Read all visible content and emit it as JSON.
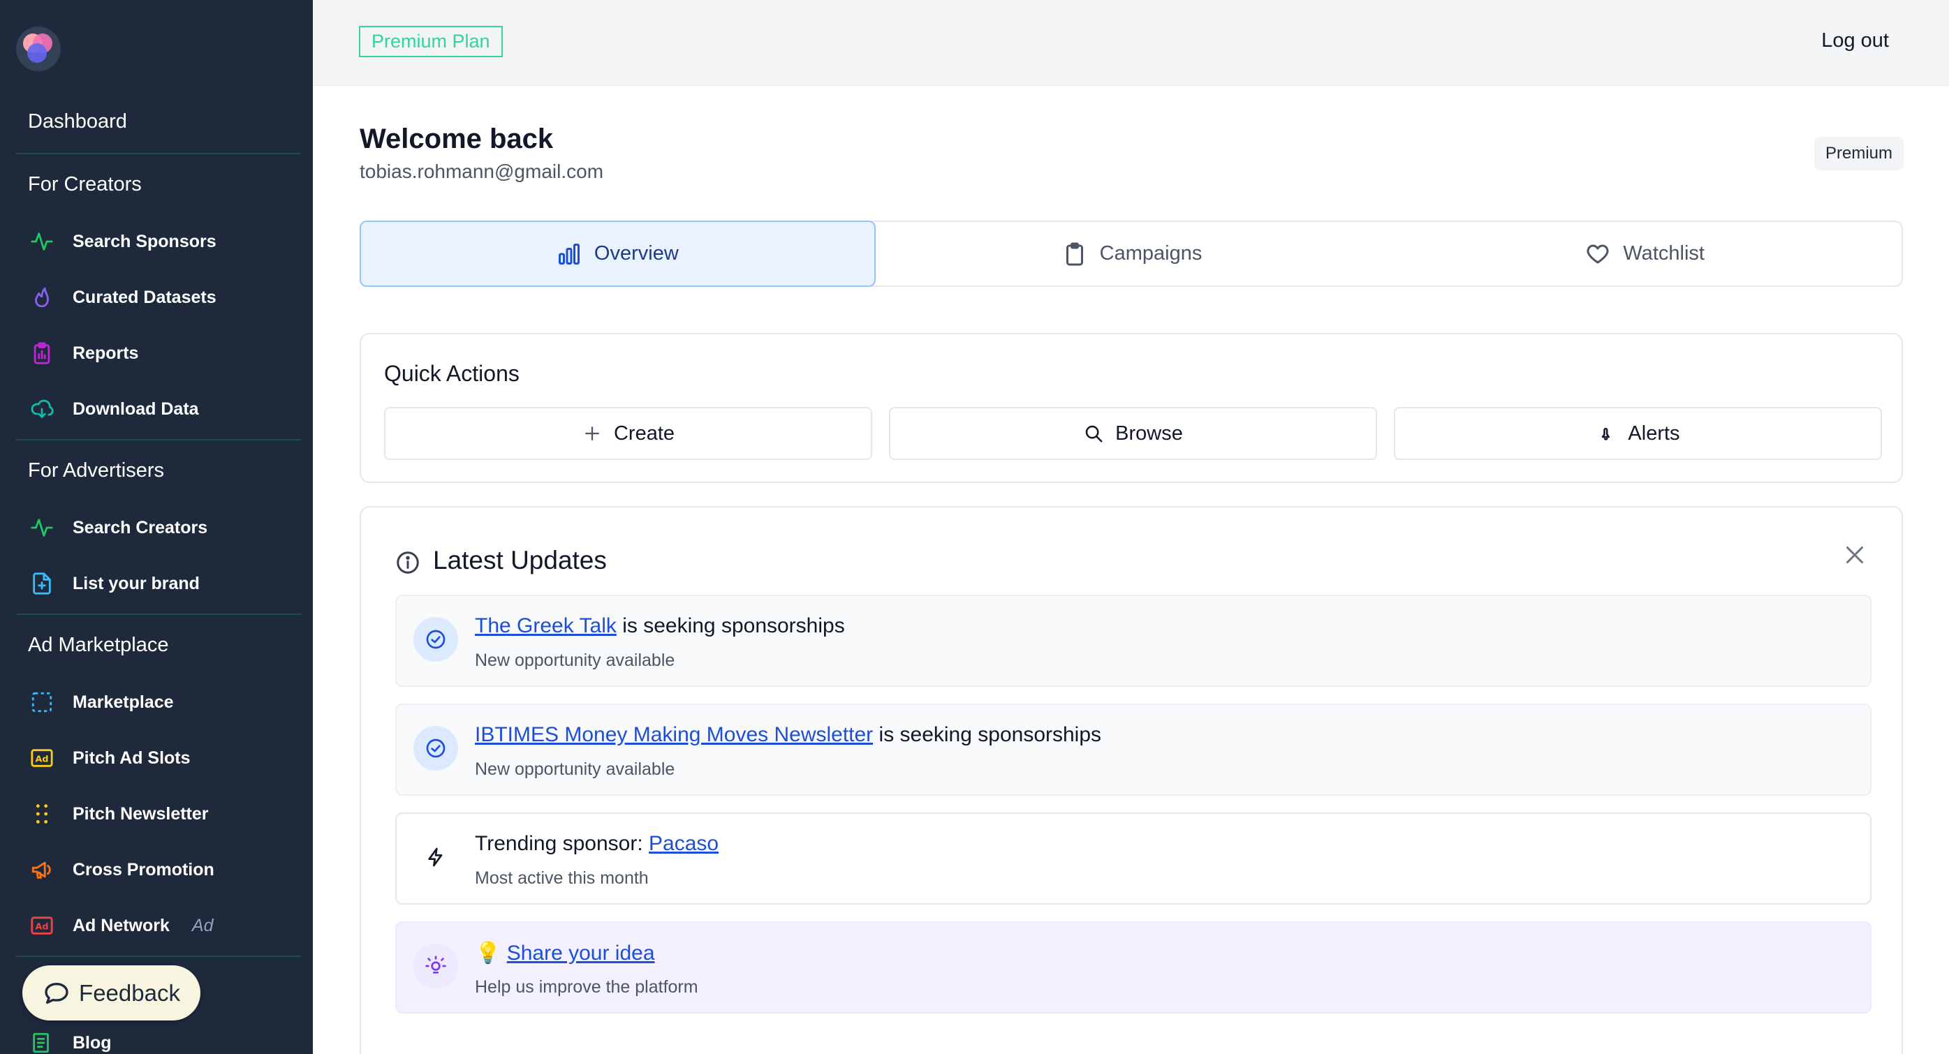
{
  "sidebar": {
    "sections": {
      "dashboard": "Dashboard",
      "creators": "For Creators",
      "advertisers": "For Advertisers",
      "marketplace": "Ad Marketplace"
    },
    "items": [
      {
        "label": "Search Sponsors",
        "icon": "activity-icon",
        "color": "#22c55e"
      },
      {
        "label": "Curated Datasets",
        "icon": "flame-icon",
        "color": "#8b5cf6"
      },
      {
        "label": "Reports",
        "icon": "clipboard-chart-icon",
        "color": "#c026d3"
      },
      {
        "label": "Download Data",
        "icon": "cloud-download-icon",
        "color": "#14b8a6"
      },
      {
        "label": "Search Creators",
        "icon": "activity-icon",
        "color": "#22c55e"
      },
      {
        "label": "List your brand",
        "icon": "file-plus-icon",
        "color": "#38bdf8"
      },
      {
        "label": "Marketplace",
        "icon": "dashed-square-icon",
        "color": "#38bdf8"
      },
      {
        "label": "Pitch Ad Slots",
        "icon": "ad-icon",
        "color": "#facc15"
      },
      {
        "label": "Pitch Newsletter",
        "icon": "dots-icon",
        "color": "#facc15"
      },
      {
        "label": "Cross Promotion",
        "icon": "megaphone-icon",
        "color": "#f97316"
      },
      {
        "label": "Ad Network",
        "icon": "ad-icon",
        "color": "#ef4444",
        "suffix": "Ad"
      },
      {
        "label": "Blog",
        "icon": "newspaper-icon",
        "color": "#22c55e"
      }
    ],
    "feedback_label": "Feedback"
  },
  "topbar": {
    "plan_badge": "Premium Plan",
    "logout": "Log out"
  },
  "main": {
    "welcome": "Welcome back",
    "email": "tobias.rohmann@gmail.com",
    "premium_tag": "Premium",
    "tabs": [
      {
        "label": "Overview",
        "icon": "bar-chart-icon",
        "active": true
      },
      {
        "label": "Campaigns",
        "icon": "clipboard-icon",
        "active": false
      },
      {
        "label": "Watchlist",
        "icon": "heart-icon",
        "active": false
      }
    ],
    "quick_actions": {
      "title": "Quick Actions",
      "buttons": [
        {
          "label": "Create",
          "icon": "plus-icon"
        },
        {
          "label": "Browse",
          "icon": "search-icon"
        },
        {
          "label": "Alerts",
          "icon": "bell-icon"
        }
      ]
    },
    "updates": {
      "title": "Latest Updates",
      "items": [
        {
          "link": "The Greek Talk",
          "text": " is seeking sponsorships",
          "sub": "New opportunity available"
        },
        {
          "link": "IBTIMES Money Making Moves Newsletter",
          "text": " is seeking sponsorships",
          "sub": "New opportunity available"
        },
        {
          "prefix": "Trending sponsor: ",
          "link": "Pacaso",
          "sub": "Most active this month"
        },
        {
          "prefix": "💡 ",
          "link": "Share your idea",
          "sub": "Help us improve the platform"
        }
      ]
    }
  },
  "colors": {
    "sidebar_bg": "#1e293b",
    "accent_blue": "#1d4ed8",
    "plan_green": "#34d399"
  }
}
